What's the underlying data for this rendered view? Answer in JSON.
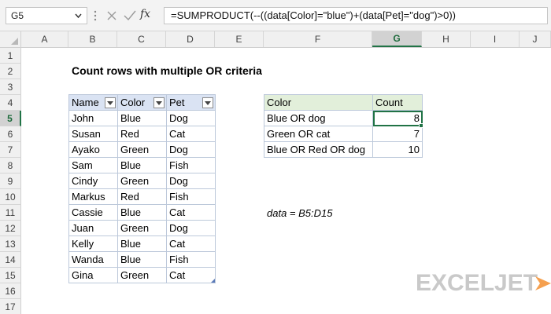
{
  "formula_bar": {
    "name_box": "G5",
    "fx_label": "fx",
    "formula": "=SUMPRODUCT(--((data[Color]=\"blue\")+(data[Pet]=\"dog\")>0))"
  },
  "columns": [
    "A",
    "B",
    "C",
    "D",
    "E",
    "F",
    "G",
    "H",
    "I",
    "J"
  ],
  "rows": [
    "1",
    "2",
    "3",
    "4",
    "5",
    "6",
    "7",
    "8",
    "9",
    "10",
    "11",
    "12",
    "13",
    "14",
    "15",
    "16",
    "17"
  ],
  "active_cell": {
    "column": "G",
    "row": "5"
  },
  "sheet": {
    "title": "Count rows with multiple OR criteria",
    "data_table": {
      "headers": [
        "Name",
        "Color",
        "Pet"
      ],
      "rows": [
        [
          "John",
          "Blue",
          "Dog"
        ],
        [
          "Susan",
          "Red",
          "Cat"
        ],
        [
          "Ayako",
          "Green",
          "Dog"
        ],
        [
          "Sam",
          "Blue",
          "Fish"
        ],
        [
          "Cindy",
          "Green",
          "Dog"
        ],
        [
          "Markus",
          "Red",
          "Fish"
        ],
        [
          "Cassie",
          "Blue",
          "Cat"
        ],
        [
          "Juan",
          "Green",
          "Dog"
        ],
        [
          "Kelly",
          "Blue",
          "Cat"
        ],
        [
          "Wanda",
          "Blue",
          "Fish"
        ],
        [
          "Gina",
          "Green",
          "Cat"
        ]
      ]
    },
    "summary_table": {
      "headers": [
        "Color",
        "Count"
      ],
      "rows": [
        [
          "Blue OR dog",
          "8"
        ],
        [
          "Green OR cat",
          "7"
        ],
        [
          "Blue OR Red OR dog",
          "10"
        ]
      ]
    },
    "note": "data = B5:D15"
  },
  "watermark": {
    "text": "EXCELJET"
  },
  "colors": {
    "accent_green": "#217346",
    "table_header_blue": "#dae3f3",
    "summary_header_green": "#e2efda",
    "logo_gray": "#c9c9c9",
    "logo_orange": "#f5a04f"
  }
}
